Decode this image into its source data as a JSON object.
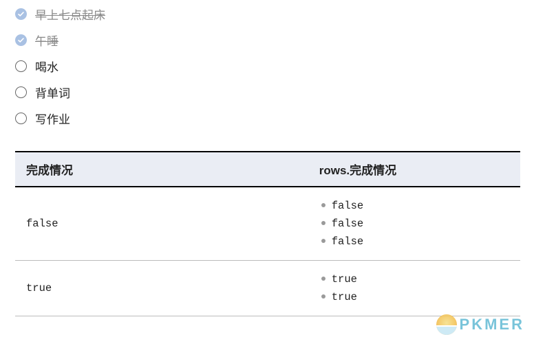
{
  "todos": [
    {
      "label": "早上七点起床",
      "done": true
    },
    {
      "label": "午睡",
      "done": true
    },
    {
      "label": "喝水",
      "done": false
    },
    {
      "label": "背单词",
      "done": false
    },
    {
      "label": "写作业",
      "done": false
    }
  ],
  "table": {
    "headers": [
      "完成情况",
      "rows.完成情况"
    ],
    "rows": [
      {
        "key": "false",
        "values": [
          "false",
          "false",
          "false"
        ]
      },
      {
        "key": "true",
        "values": [
          "true",
          "true"
        ]
      }
    ]
  },
  "watermark": {
    "text": "PKMER"
  }
}
